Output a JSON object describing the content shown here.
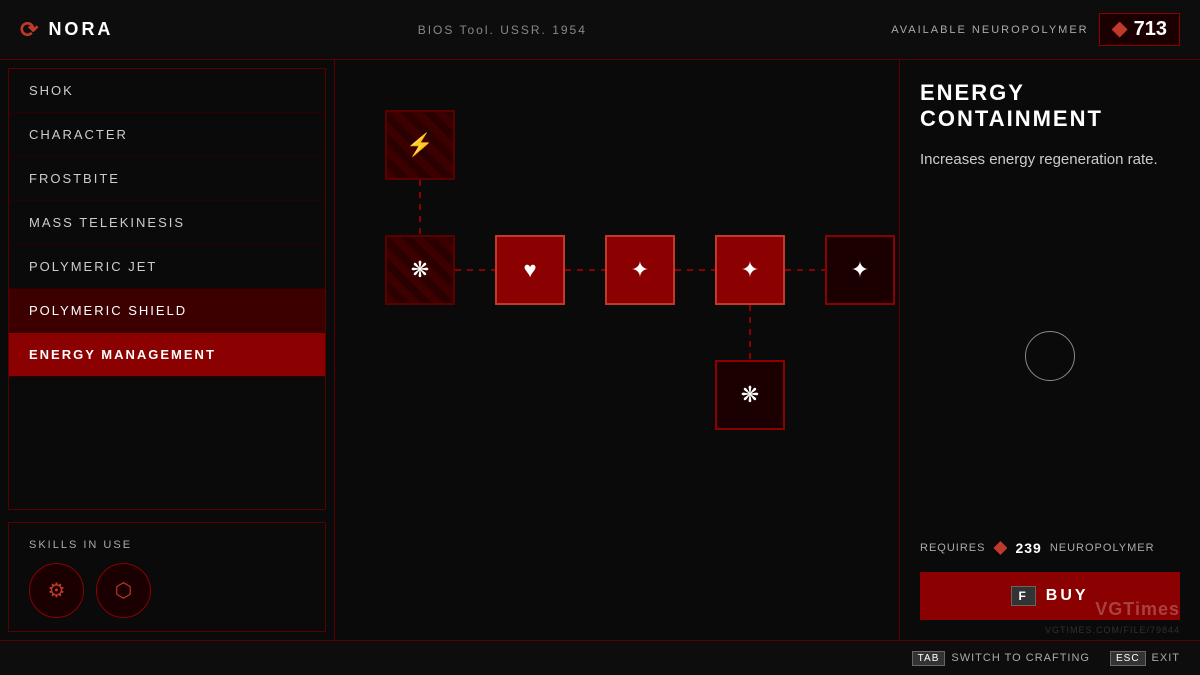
{
  "header": {
    "logo": "⟳",
    "character_name": "NORA",
    "center_text": "BIOS Tool. USSR. 1954",
    "neuro_label": "AVAILABLE NEUROPOLYMER",
    "neuro_count": "713"
  },
  "nav": {
    "items": [
      {
        "label": "SHOK",
        "state": "normal"
      },
      {
        "label": "CHARACTER",
        "state": "normal"
      },
      {
        "label": "FROSTBITE",
        "state": "normal"
      },
      {
        "label": "MASS TELEKINESIS",
        "state": "normal"
      },
      {
        "label": "POLYMERIC JET",
        "state": "normal"
      },
      {
        "label": "POLYMERIC SHIELD",
        "state": "highlight"
      },
      {
        "label": "ENERGY MANAGEMENT",
        "state": "active"
      }
    ]
  },
  "skills_in_use": {
    "label": "SKILLS IN USE",
    "skills": [
      {
        "icon": "⚙"
      },
      {
        "icon": "⬡"
      }
    ]
  },
  "skill_detail": {
    "title": "ENERGY CONTAINMENT",
    "description": "Increases energy regeneration rate.",
    "requires_label": "REQUIRES",
    "requires_amount": "239",
    "requires_suffix": "NEUROPOLYMER",
    "buy_key": "F",
    "buy_label": "BUY"
  },
  "footer": {
    "tab_key": "TAB",
    "tab_label": "SWITCH TO CRAFTING",
    "esc_key": "ESC",
    "esc_label": "EXIT"
  },
  "nodes": [
    {
      "id": "node1",
      "row": 0,
      "col": 0,
      "state": "locked",
      "icon": "⚡"
    },
    {
      "id": "node2",
      "row": 1,
      "col": 0,
      "state": "locked",
      "icon": "❋"
    },
    {
      "id": "node3",
      "row": 1,
      "col": 1,
      "state": "active",
      "icon": "♥"
    },
    {
      "id": "node4",
      "row": 1,
      "col": 2,
      "state": "active",
      "icon": "✦"
    },
    {
      "id": "node5",
      "row": 1,
      "col": 3,
      "state": "active",
      "icon": "✦"
    },
    {
      "id": "node6",
      "row": 1,
      "col": 4,
      "state": "normal",
      "icon": "✦"
    },
    {
      "id": "node7",
      "row": 2,
      "col": 3,
      "state": "normal",
      "icon": "❋"
    }
  ]
}
